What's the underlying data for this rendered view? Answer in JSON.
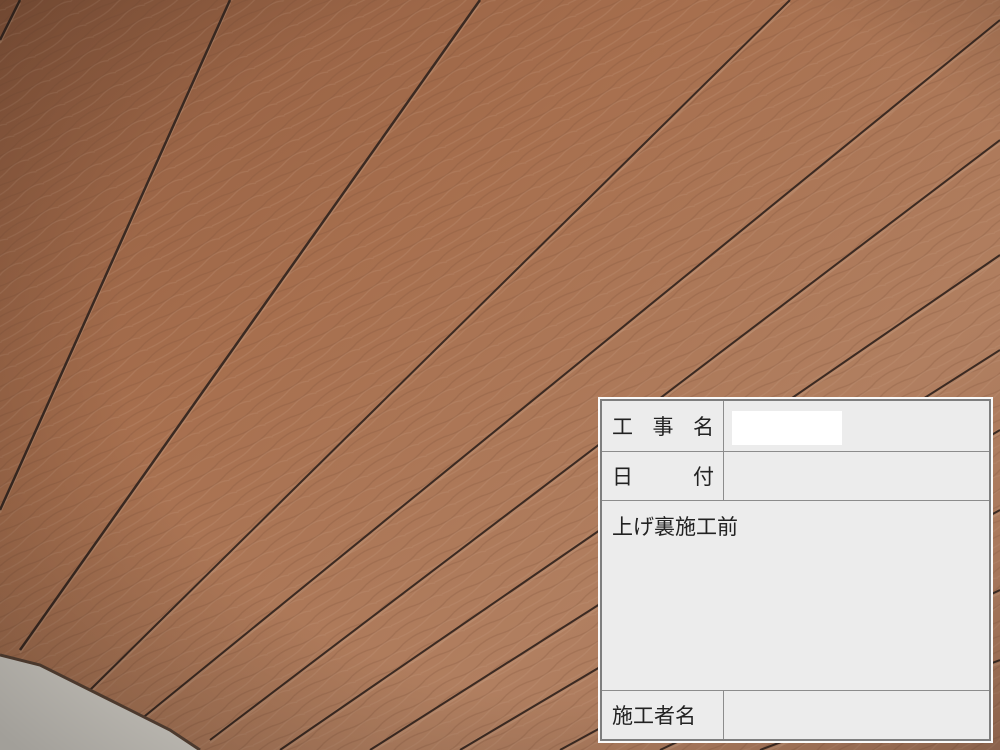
{
  "photo": {
    "subject": "wooden-grain soffit ceiling boards",
    "colors": {
      "wood_light": "#b9896a",
      "wood_mid": "#a5704f",
      "wood_dark": "#8a5a40",
      "groove": "#3b2a22",
      "stucco": "#d8d4cc"
    }
  },
  "board": {
    "construction_name_label": [
      "工",
      "事",
      "名"
    ],
    "construction_name_value": "",
    "date_label": [
      "日",
      "付"
    ],
    "date_value": "",
    "note": "上げ裏施工前",
    "contractor_label": "施工者名",
    "contractor_value": ""
  }
}
